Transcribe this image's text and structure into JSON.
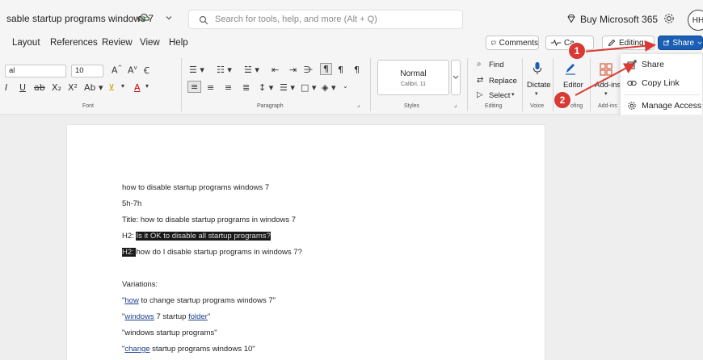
{
  "titlebar": {
    "doc_title": "sable startup programs windows 7",
    "search_placeholder": "Search for tools, help, and more (Alt + Q)",
    "buy_label": "Buy Microsoft 365",
    "avatar_initials": "HH"
  },
  "menu": {
    "items": [
      "Layout",
      "References",
      "Review",
      "View",
      "Help"
    ],
    "comments_label": "Comments",
    "catchup_label": "Ca",
    "editing_label": "Editing",
    "share_label": "Share"
  },
  "ribbon": {
    "font_name": "al",
    "font_size": "10",
    "font_label": "Font",
    "paragraph_label": "Paragraph",
    "styles_label": "Styles",
    "style_current": "Normal",
    "style_sub": "Calibri, 11",
    "find_label": "Find",
    "replace_label": "Replace",
    "select_label": "Select",
    "editing_group_label": "Editing",
    "dictate_label": "Dictate",
    "voice_label": "Voice",
    "editor_label": "Editor",
    "proofing_label": "ofing",
    "addins_label": "Add-ins",
    "addins_group_label": "Add-ins"
  },
  "share_menu": {
    "items": [
      {
        "label": "Share",
        "icon": "share-icon"
      },
      {
        "label": "Copy Link",
        "icon": "link-icon"
      },
      {
        "label": "Manage Access",
        "icon": "gear-icon"
      }
    ]
  },
  "annotations": {
    "badge1": "1",
    "badge2": "2",
    "color": "#d93a33"
  },
  "document": {
    "line1": "how to disable startup programs windows 7",
    "line2": "5h-7h",
    "line3": "Title: how to disable startup programs in windows 7",
    "h2a_prefix": "H2: ",
    "h2a_text": "Is it OK to disable all startup programs?",
    "h2b_prefix": "H2: ",
    "h2b_text": "how do I disable startup programs in windows 7?",
    "variations": "Variations:",
    "v1_q1": "\"",
    "v1_link": "how",
    "v1_rest": " to change startup programs windows 7\"",
    "v2_q": "\"",
    "v2_link1": "windows",
    "v2_mid": " 7 startup ",
    "v2_link2": "folder",
    "v2_end": "\"",
    "v3": "\"windows startup programs\"",
    "v4_q": "\"",
    "v4_link": "change",
    "v4_rest": " startup programs windows 10\""
  },
  "colors": {
    "share_button": "#1a5fb4",
    "annotation_red": "#d93a33"
  }
}
